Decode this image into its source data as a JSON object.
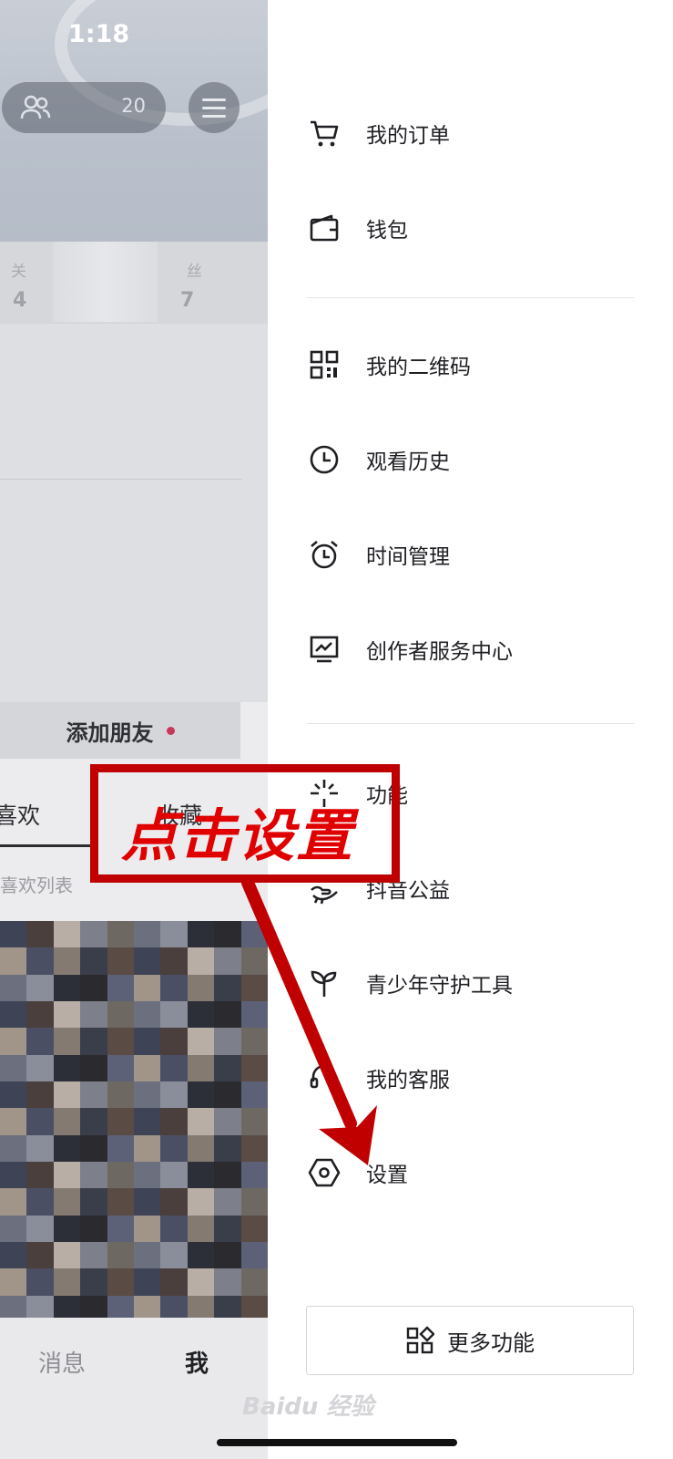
{
  "status_bar": {
    "time": "1:18"
  },
  "profile_page": {
    "friends_count": "20",
    "stats": [
      {
        "label": "关",
        "value": "4"
      },
      {
        "label": "丝",
        "value": "7"
      }
    ],
    "add_friend_label": "添加朋友",
    "tabs": [
      {
        "label": "喜欢"
      },
      {
        "label": "收藏"
      }
    ],
    "likes_hint": "喜欢列表",
    "bottom_nav": [
      {
        "label": "消息"
      },
      {
        "label": "我"
      }
    ]
  },
  "drawer": {
    "items": [
      {
        "label": "我的订单",
        "icon": "cart-icon"
      },
      {
        "label": "钱包",
        "icon": "wallet-icon"
      },
      {
        "label": "我的二维码",
        "icon": "qr-code-icon"
      },
      {
        "label": "观看历史",
        "icon": "clock-icon"
      },
      {
        "label": "时间管理",
        "icon": "alarm-clock-icon"
      },
      {
        "label": "创作者服务中心",
        "icon": "chart-monitor-icon"
      },
      {
        "label": "功能",
        "icon": "sparkle-icon"
      },
      {
        "label": "抖音公益",
        "icon": "charity-hand-icon"
      },
      {
        "label": "青少年守护工具",
        "icon": "sprout-icon"
      },
      {
        "label": "我的客服",
        "icon": "headset-icon"
      },
      {
        "label": "设置",
        "icon": "hexagon-settings-icon"
      }
    ],
    "more_button_label": "更多功能"
  },
  "annotation": {
    "text": "点击设置",
    "color": "#c00000"
  },
  "watermark": {
    "text": "Baidu 经验"
  }
}
